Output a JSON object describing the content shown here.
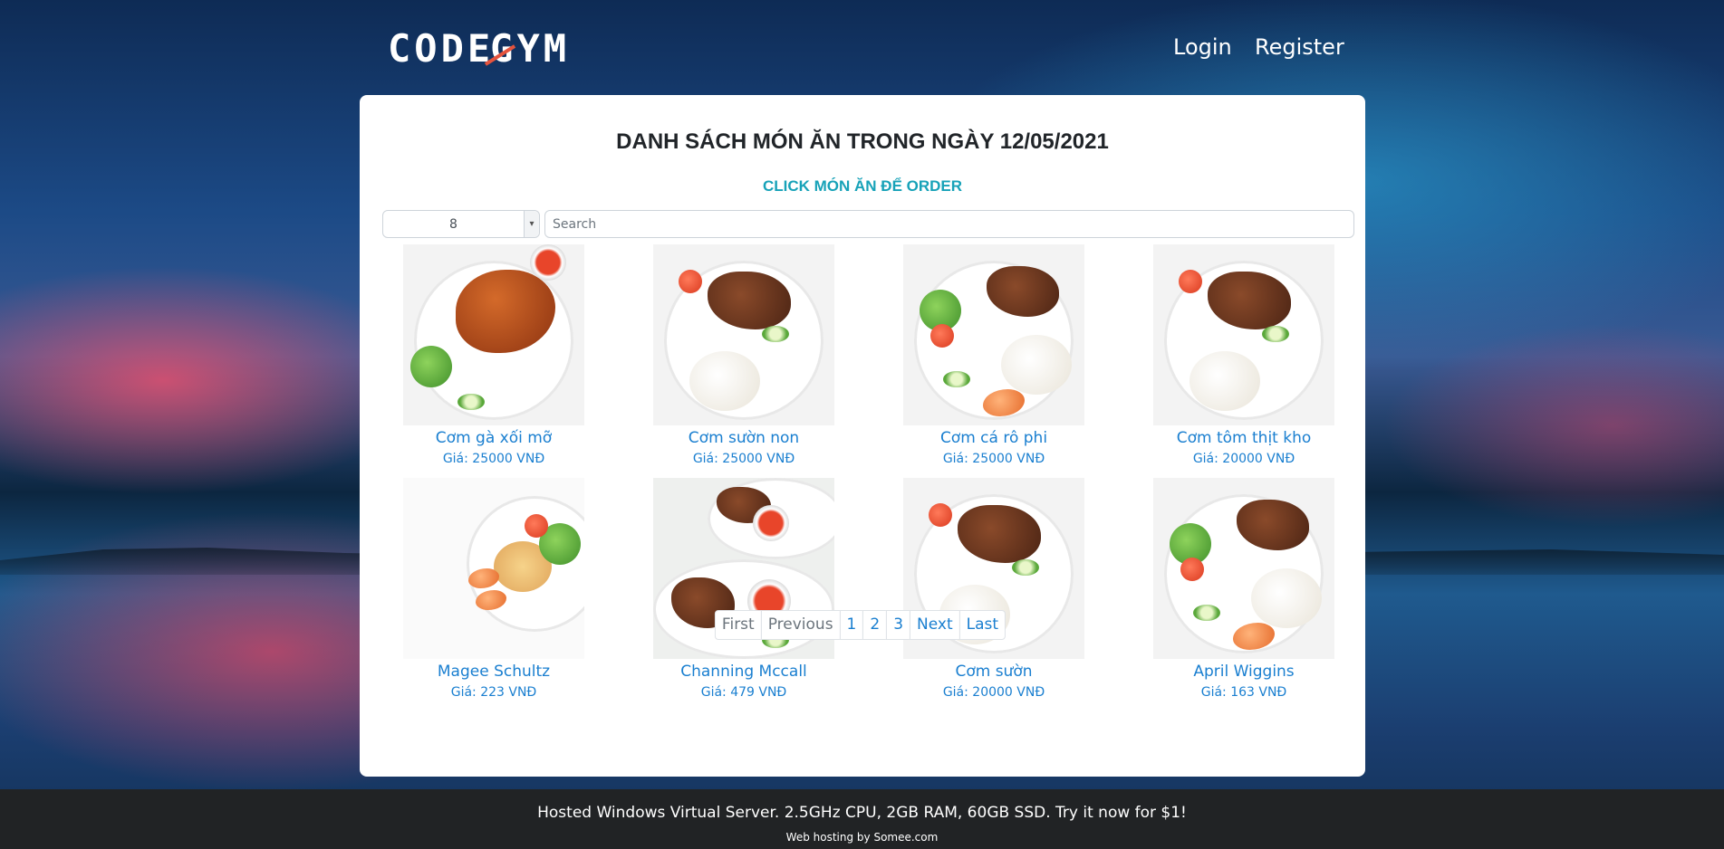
{
  "header": {
    "logo": "CODEGYM",
    "nav": {
      "login": "Login",
      "register": "Register"
    }
  },
  "main": {
    "title": "DANH SÁCH MÓN ĂN TRONG NGÀY 12/05/2021",
    "subtitle": "CLICK MÓN ĂN ĐỂ ORDER",
    "page_size": "8",
    "search_placeholder": "Search",
    "foods": [
      {
        "name": "Cơm gà xối mỡ",
        "price": "Giá: 25000 VNĐ"
      },
      {
        "name": "Cơm sườn non",
        "price": "Giá: 25000 VNĐ"
      },
      {
        "name": "Cơm cá rô phi",
        "price": "Giá: 25000 VNĐ"
      },
      {
        "name": "Cơm tôm thịt kho",
        "price": "Giá: 20000 VNĐ"
      },
      {
        "name": "Magee Schultz",
        "price": "Giá: 223 VNĐ"
      },
      {
        "name": "Channing Mccall",
        "price": "Giá: 479 VNĐ"
      },
      {
        "name": "Cơm sườn",
        "price": "Giá: 20000 VNĐ"
      },
      {
        "name": "April Wiggins",
        "price": "Giá: 163 VNĐ"
      }
    ],
    "pagination": {
      "first": "First",
      "previous": "Previous",
      "pages": [
        "1",
        "2",
        "3"
      ],
      "next": "Next",
      "last": "Last"
    }
  },
  "footer": {
    "ad": "Hosted Windows Virtual Server. 2.5GHz CPU, 2GB RAM, 60GB SSD. Try it now for $1!",
    "host": "Web hosting by Somee.com"
  }
}
